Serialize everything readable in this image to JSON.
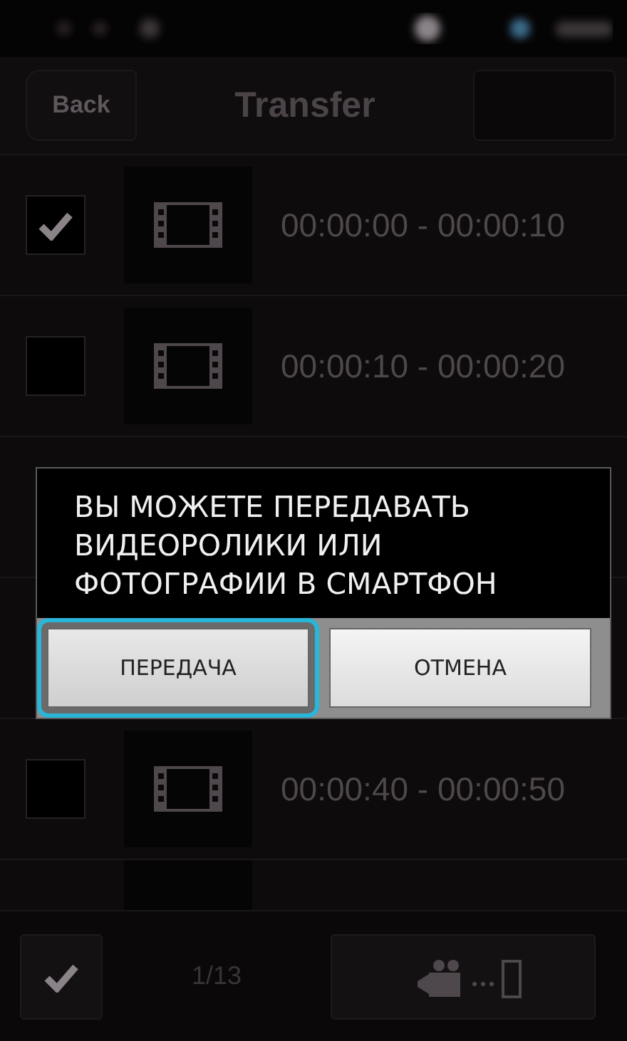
{
  "header": {
    "back": "Back",
    "title": "Transfer"
  },
  "rows": [
    {
      "checked": true,
      "time": "00:00:00 - 00:00:10"
    },
    {
      "checked": false,
      "time": "00:00:10 - 00:00:20"
    },
    {},
    {},
    {
      "checked": false,
      "time": "00:00:40 - 00:00:50"
    }
  ],
  "dialog": {
    "message": "ВЫ МОЖЕТЕ ПЕРЕДАВАТЬ ВИДЕОРОЛИКИ ИЛИ ФОТОГРАФИИ В СМАРТФОН",
    "buttons": [
      {
        "label": "ПЕРЕДАЧА",
        "selected": true
      },
      {
        "label": "ОТМЕНА",
        "selected": false
      }
    ]
  },
  "footer": {
    "select_all_checked": true,
    "count": "1/13"
  }
}
